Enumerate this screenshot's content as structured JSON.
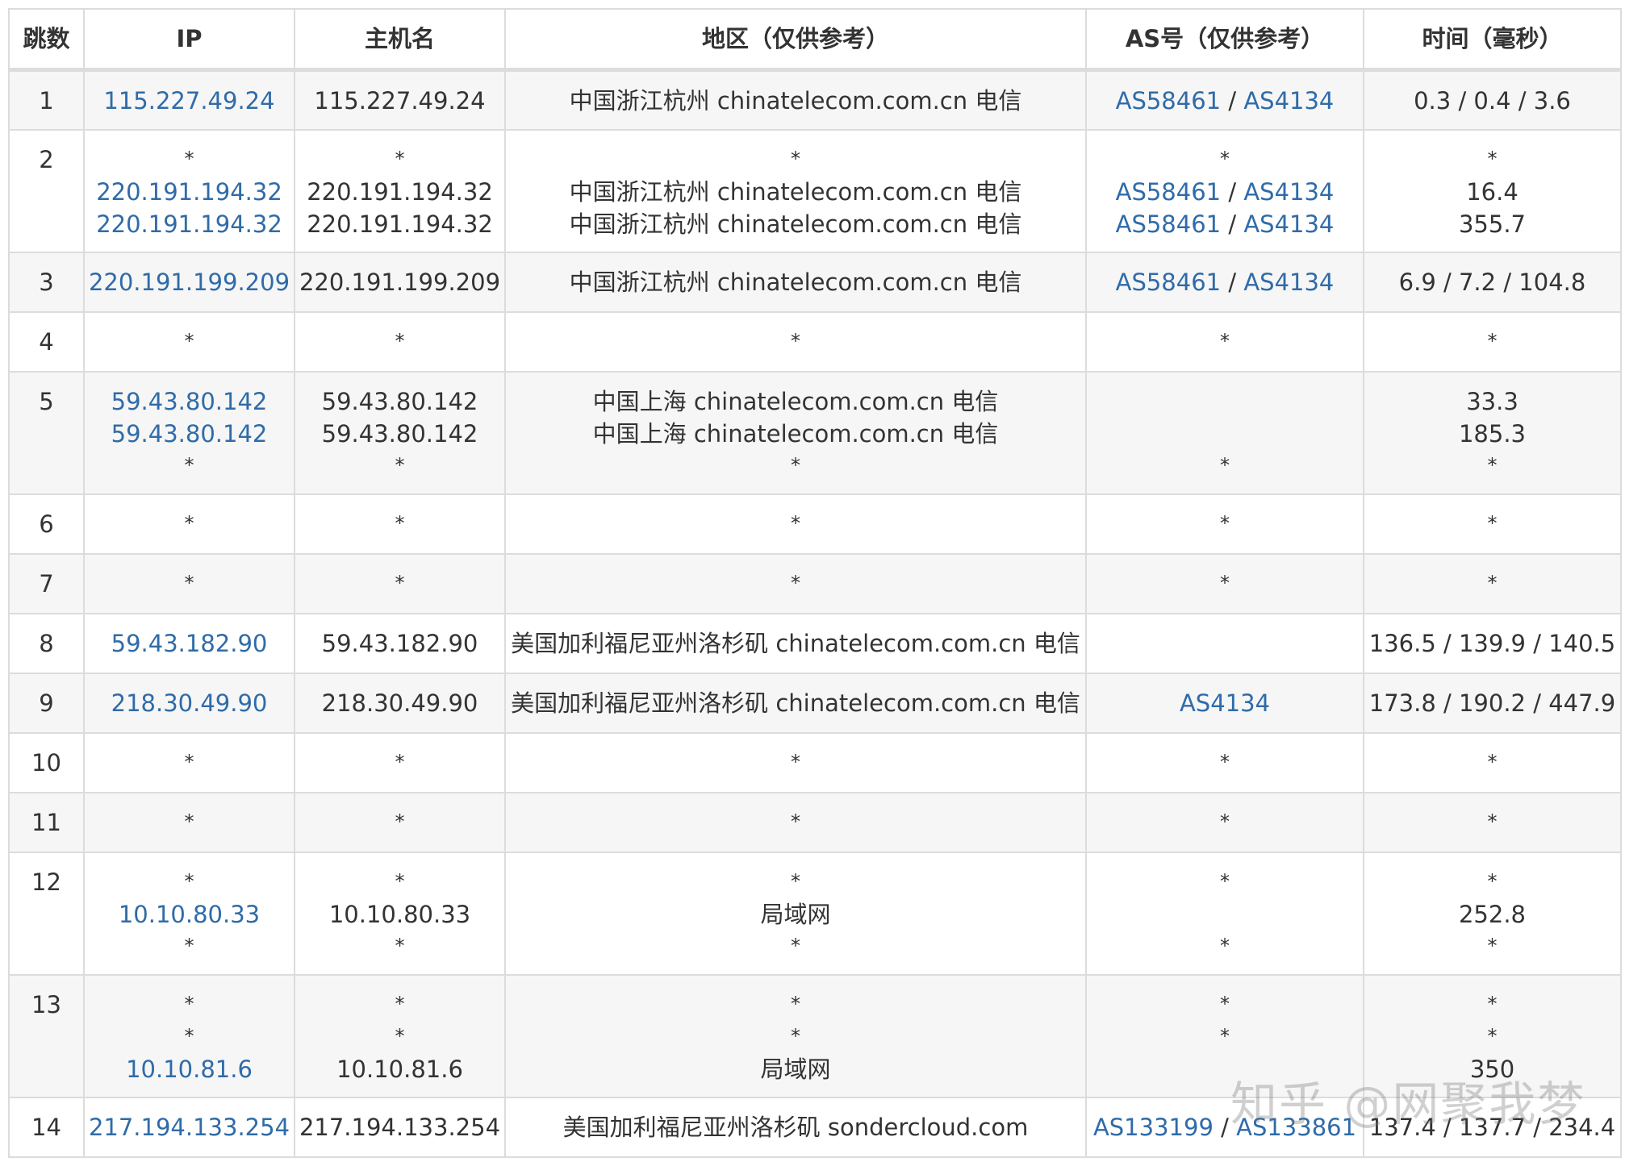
{
  "table": {
    "headers": [
      "跳数",
      "IP",
      "主机名",
      "地区（仅供参考）",
      "AS号（仅供参考）",
      "时间（毫秒）"
    ],
    "rows": [
      {
        "hop": "1",
        "ip": [
          "115.227.49.24"
        ],
        "host": [
          "115.227.49.24"
        ],
        "region": [
          "中国浙江杭州 chinatelecom.com.cn 电信"
        ],
        "as": [
          [
            "AS58461",
            "AS4134"
          ]
        ],
        "time": [
          "0.3 / 0.4 / 3.6"
        ]
      },
      {
        "hop": "2",
        "ip": [
          "*",
          "220.191.194.32",
          "220.191.194.32"
        ],
        "host": [
          "*",
          "220.191.194.32",
          "220.191.194.32"
        ],
        "region": [
          "*",
          "中国浙江杭州 chinatelecom.com.cn 电信",
          "中国浙江杭州 chinatelecom.com.cn 电信"
        ],
        "as": [
          [
            "*"
          ],
          [
            "AS58461",
            "AS4134"
          ],
          [
            "AS58461",
            "AS4134"
          ]
        ],
        "time": [
          "*",
          "16.4",
          "355.7"
        ]
      },
      {
        "hop": "3",
        "ip": [
          "220.191.199.209"
        ],
        "host": [
          "220.191.199.209"
        ],
        "region": [
          "中国浙江杭州 chinatelecom.com.cn 电信"
        ],
        "as": [
          [
            "AS58461",
            "AS4134"
          ]
        ],
        "time": [
          "6.9 / 7.2 / 104.8"
        ]
      },
      {
        "hop": "4",
        "ip": [
          "*"
        ],
        "host": [
          "*"
        ],
        "region": [
          "*"
        ],
        "as": [
          [
            "*"
          ]
        ],
        "time": [
          "*"
        ]
      },
      {
        "hop": "5",
        "ip": [
          "59.43.80.142",
          "59.43.80.142",
          "*"
        ],
        "host": [
          "59.43.80.142",
          "59.43.80.142",
          "*"
        ],
        "region": [
          "中国上海 chinatelecom.com.cn 电信",
          "中国上海 chinatelecom.com.cn 电信",
          "*"
        ],
        "as": [
          [
            ""
          ],
          [
            ""
          ],
          [
            "*"
          ]
        ],
        "time": [
          "33.3",
          "185.3",
          "*"
        ]
      },
      {
        "hop": "6",
        "ip": [
          "*"
        ],
        "host": [
          "*"
        ],
        "region": [
          "*"
        ],
        "as": [
          [
            "*"
          ]
        ],
        "time": [
          "*"
        ]
      },
      {
        "hop": "7",
        "ip": [
          "*"
        ],
        "host": [
          "*"
        ],
        "region": [
          "*"
        ],
        "as": [
          [
            "*"
          ]
        ],
        "time": [
          "*"
        ]
      },
      {
        "hop": "8",
        "ip": [
          "59.43.182.90"
        ],
        "host": [
          "59.43.182.90"
        ],
        "region": [
          "美国加利福尼亚州洛杉矶 chinatelecom.com.cn 电信"
        ],
        "as": [
          [
            ""
          ]
        ],
        "time": [
          "136.5 / 139.9 / 140.5"
        ]
      },
      {
        "hop": "9",
        "ip": [
          "218.30.49.90"
        ],
        "host": [
          "218.30.49.90"
        ],
        "region": [
          "美国加利福尼亚州洛杉矶 chinatelecom.com.cn 电信"
        ],
        "as": [
          [
            "AS4134"
          ]
        ],
        "time": [
          "173.8 / 190.2 / 447.9"
        ]
      },
      {
        "hop": "10",
        "ip": [
          "*"
        ],
        "host": [
          "*"
        ],
        "region": [
          "*"
        ],
        "as": [
          [
            "*"
          ]
        ],
        "time": [
          "*"
        ]
      },
      {
        "hop": "11",
        "ip": [
          "*"
        ],
        "host": [
          "*"
        ],
        "region": [
          "*"
        ],
        "as": [
          [
            "*"
          ]
        ],
        "time": [
          "*"
        ]
      },
      {
        "hop": "12",
        "ip": [
          "*",
          "10.10.80.33",
          "*"
        ],
        "host": [
          "*",
          "10.10.80.33",
          "*"
        ],
        "region": [
          "*",
          "局域网",
          "*"
        ],
        "as": [
          [
            "*"
          ],
          [
            ""
          ],
          [
            "*"
          ]
        ],
        "time": [
          "*",
          "252.8",
          "*"
        ]
      },
      {
        "hop": "13",
        "ip": [
          "*",
          "*",
          "10.10.81.6"
        ],
        "host": [
          "*",
          "*",
          "10.10.81.6"
        ],
        "region": [
          "*",
          "*",
          "局域网"
        ],
        "as": [
          [
            "*"
          ],
          [
            "*"
          ],
          [
            ""
          ]
        ],
        "time": [
          "*",
          "*",
          "350"
        ]
      },
      {
        "hop": "14",
        "ip": [
          "217.194.133.254"
        ],
        "host": [
          "217.194.133.254"
        ],
        "region": [
          "美国加利福尼亚州洛杉矶 sondercloud.com"
        ],
        "as": [
          [
            "AS133199",
            "AS133861"
          ]
        ],
        "time": [
          "137.4 / 137.7 / 234.4"
        ]
      }
    ]
  },
  "watermark": "知乎 @网聚我梦",
  "colors": {
    "link": "#2f6ba8",
    "border": "#dcdcdc",
    "row_alt": "#f6f6f6",
    "text": "#333333"
  }
}
